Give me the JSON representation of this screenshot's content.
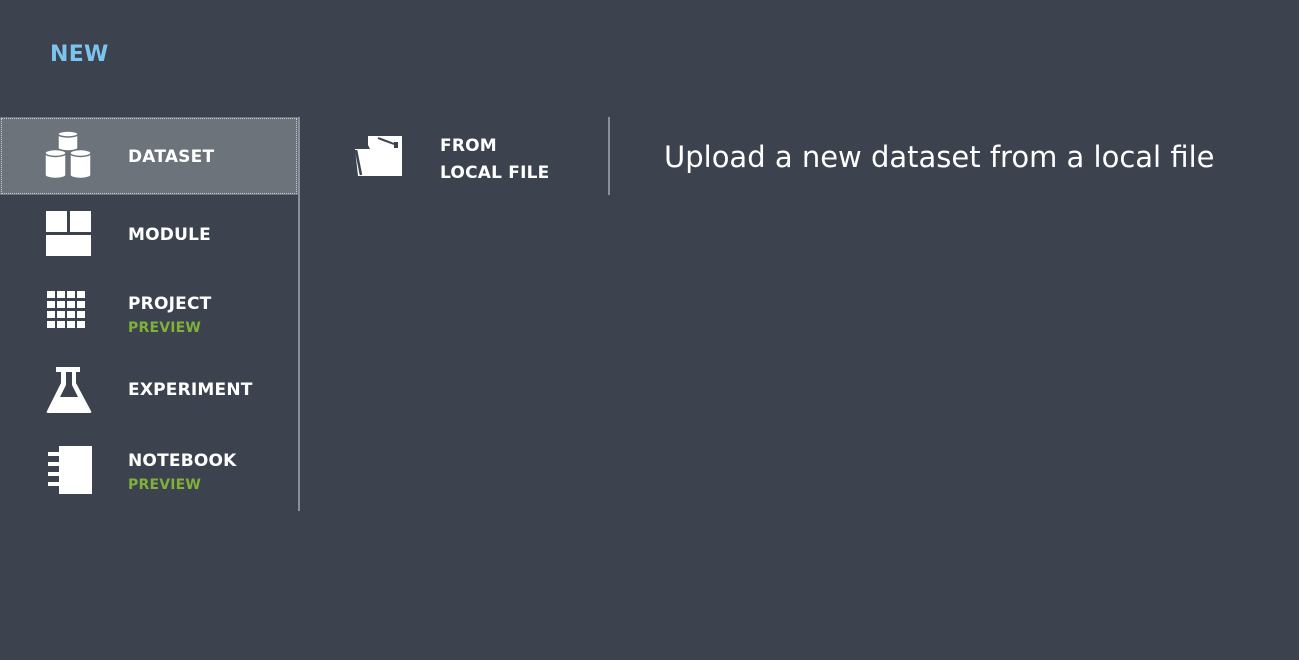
{
  "header": {
    "title": "NEW"
  },
  "menu": {
    "items": [
      {
        "label": "DATASET",
        "icon": "database-stack-icon",
        "selected": true
      },
      {
        "label": "MODULE",
        "icon": "module-blocks-icon"
      },
      {
        "label": "PROJECT",
        "badge": "PREVIEW",
        "icon": "grid-icon"
      },
      {
        "label": "EXPERIMENT",
        "icon": "flask-icon"
      },
      {
        "label": "NOTEBOOK",
        "badge": "PREVIEW",
        "icon": "notebook-icon"
      }
    ]
  },
  "options": {
    "from_local_file": {
      "line1": "FROM",
      "line2": "LOCAL FILE",
      "icon": "folder-icon"
    }
  },
  "description": "Upload a new dataset from a local file",
  "colors": {
    "background": "#3c424e",
    "title": "#7cc4ee",
    "selected": "#6d737b",
    "badge": "#7fb13a",
    "divider": "#8a909a"
  }
}
